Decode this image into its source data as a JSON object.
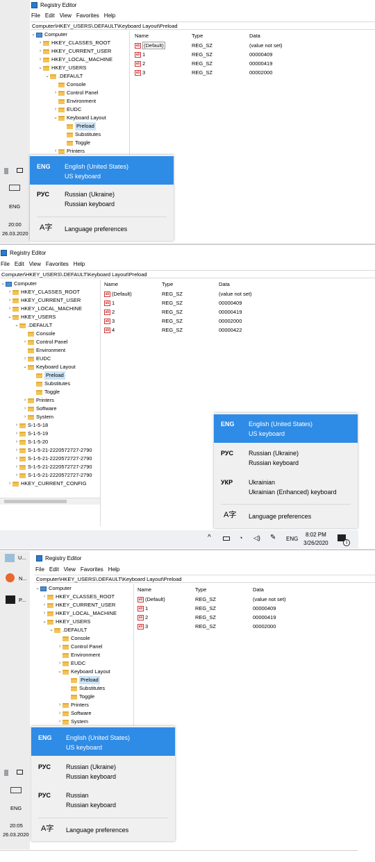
{
  "app_title": "Registry Editor",
  "menu": [
    "File",
    "Edit",
    "View",
    "Favorites",
    "Help"
  ],
  "address": "Computer\\HKEY_USERS\\.DEFAULT\\Keyboard Layout\\Preload",
  "columns": {
    "name": "Name",
    "type": "Type",
    "data": "Data"
  },
  "tree": {
    "computer": "Computer",
    "hkcr": "HKEY_CLASSES_ROOT",
    "hkcu": "HKEY_CURRENT_USER",
    "hklm": "HKEY_LOCAL_MACHINE",
    "hku": "HKEY_USERS",
    "default": ".DEFAULT",
    "console": "Console",
    "control_panel": "Control Panel",
    "environment": "Environment",
    "eudc": "EUDC",
    "keyboard_layout": "Keyboard Layout",
    "preload": "Preload",
    "substitutes": "Substitutes",
    "toggle": "Toggle",
    "printers": "Printers",
    "software": "Software",
    "system": "System",
    "s18": "S-1-5-18",
    "s19": "S-1-5-19",
    "s20": "S-1-5-20",
    "s21a": "S-1-5-21-2220572727-2790",
    "s21b": "S-1-5-21-2220572727-2790",
    "s21c": "S-1-5-21-2220572727-2790",
    "s21d": "S-1-5-21-2220572727-2790",
    "hkcc": "HKEY_CURRENT_CONFIG"
  },
  "shot1": {
    "values": [
      {
        "name": "(Default)",
        "type": "REG_SZ",
        "data": "(value not set)"
      },
      {
        "name": "1",
        "type": "REG_SZ",
        "data": "00000409"
      },
      {
        "name": "2",
        "type": "REG_SZ",
        "data": "00000419"
      },
      {
        "name": "3",
        "type": "REG_SZ",
        "data": "00002000"
      }
    ],
    "langs": [
      {
        "code": "ENG",
        "line1": "English (United States)",
        "line2": "US keyboard"
      },
      {
        "code": "РУС",
        "line1": "Russian (Ukraine)",
        "line2": "Russian keyboard"
      }
    ],
    "prefs": "Language preferences",
    "side_lang": "ENG",
    "clock_time": "20:00",
    "clock_date": "26.03.2020"
  },
  "shot2": {
    "values": [
      {
        "name": "(Default)",
        "type": "REG_SZ",
        "data": "(value not set)"
      },
      {
        "name": "1",
        "type": "REG_SZ",
        "data": "00000409"
      },
      {
        "name": "2",
        "type": "REG_SZ",
        "data": "00000419"
      },
      {
        "name": "3",
        "type": "REG_SZ",
        "data": "00002000"
      },
      {
        "name": "4",
        "type": "REG_SZ",
        "data": "00000422"
      }
    ],
    "langs": [
      {
        "code": "ENG",
        "line1": "English (United States)",
        "line2": "US keyboard"
      },
      {
        "code": "РУС",
        "line1": "Russian (Ukraine)",
        "line2": "Russian keyboard"
      },
      {
        "code": "УКР",
        "line1": "Ukrainian",
        "line2": "Ukrainian (Enhanced) keyboard"
      }
    ],
    "prefs": "Language preferences",
    "taskbar_lang": "ENG",
    "clock_time": "8:02 PM",
    "clock_date": "3/26/2020",
    "notif_count": "1"
  },
  "shot3": {
    "values": [
      {
        "name": "(Default)",
        "type": "REG_SZ",
        "data": "(value not set)"
      },
      {
        "name": "1",
        "type": "REG_SZ",
        "data": "00000409"
      },
      {
        "name": "2",
        "type": "REG_SZ",
        "data": "00000419"
      },
      {
        "name": "3",
        "type": "REG_SZ",
        "data": "00002000"
      }
    ],
    "langs": [
      {
        "code": "ENG",
        "line1": "English (United States)",
        "line2": "US keyboard"
      },
      {
        "code": "РУС",
        "line1": "Russian (Ukraine)",
        "line2": "Russian keyboard"
      },
      {
        "code": "РУС",
        "line1": "Russian",
        "line2": "Russian keyboard"
      }
    ],
    "prefs": "Language preferences",
    "side_lang": "ENG",
    "clock_time": "20:05",
    "clock_date": "26.03.2020",
    "side_apps": [
      "U...",
      "N...",
      "P..."
    ]
  }
}
